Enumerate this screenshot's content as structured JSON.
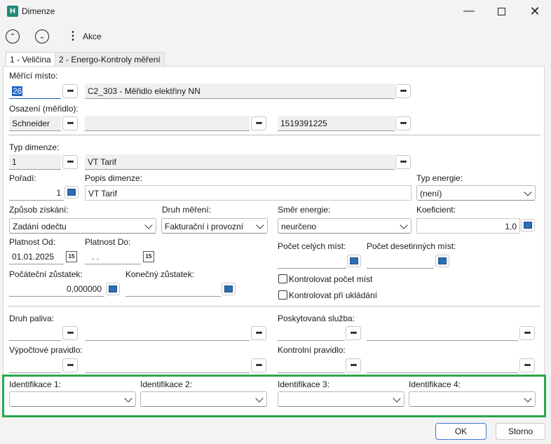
{
  "window": {
    "title": "Dimenze",
    "app_icon": "H"
  },
  "toolbar": {
    "actions_label": "Akce"
  },
  "tabs": [
    {
      "label": "1 - Veličina"
    },
    {
      "label": "2 - Energo-Kontroly měření"
    }
  ],
  "form": {
    "merici_misto": {
      "label": "Měřící místo:",
      "code": "26",
      "name": "C2_303 - Měřidlo elektřiny NN"
    },
    "osazeni": {
      "label": "Osazení (měřidlo):",
      "maker": "Schneider",
      "model": "",
      "serial": "1519391225"
    },
    "typ_dimenze": {
      "label": "Typ dimenze:",
      "code": "1",
      "name": "VT Tarif"
    },
    "poradi": {
      "label": "Pořadí:",
      "value": "1"
    },
    "popis": {
      "label": "Popis dimenze:",
      "value": "VT Tarif"
    },
    "typ_energie": {
      "label": "Typ energie:",
      "value": "(není)"
    },
    "zpusob": {
      "label": "Způsob získání:",
      "value": "Zadání odečtu"
    },
    "druh_mereni": {
      "label": "Druh měření:",
      "value": "Fakturační i provozní"
    },
    "smer": {
      "label": "Směr energie:",
      "value": "neurčeno"
    },
    "koeficient": {
      "label": "Koeficient:",
      "value": "1,0"
    },
    "platnost_od": {
      "label": "Platnost Od:",
      "value": "01.01.2025"
    },
    "platnost_do": {
      "label": "Platnost Do:",
      "value": ". ."
    },
    "pocet_celych": {
      "label": "Počet celých míst:",
      "value": ""
    },
    "pocet_des": {
      "label": "Počet desetinných míst:",
      "value": ""
    },
    "pocatecni": {
      "label": "Počáteční zůstatek:",
      "value": "0,000000"
    },
    "konecny": {
      "label": "Konečný zůstatek:",
      "value": ""
    },
    "kontrolovat_pocet": {
      "label": "Kontrolovat počet míst",
      "checked": false
    },
    "kontrolovat_ukladani": {
      "label": "Kontrolovat při ukládání",
      "checked": false
    },
    "druh_paliva": {
      "label": "Druh paliva:"
    },
    "poskytovana_sluzba": {
      "label": "Poskytovaná služba:"
    },
    "vypoctove": {
      "label": "Výpočtové pravidlo:"
    },
    "kontrolni": {
      "label": "Kontrolní pravidlo:"
    },
    "identifikace": [
      {
        "label": "Identifikace 1:",
        "value": ""
      },
      {
        "label": "Identifikace 2:",
        "value": ""
      },
      {
        "label": "Identifikace 3:",
        "value": ""
      },
      {
        "label": "Identifikace 4:",
        "value": ""
      }
    ]
  },
  "buttons": {
    "ok": "OK",
    "cancel": "Storno"
  },
  "colors": {
    "highlight_box": "#2aa84a",
    "ok_border": "#3b7bd4"
  },
  "icons": [
    "app-icon",
    "minimize-icon",
    "maximize-icon",
    "close-icon",
    "chevron-up-icon",
    "chevron-down-icon",
    "more-vertical-icon",
    "ellipsis-icon",
    "calculator-icon",
    "calendar-icon",
    "dropdown-chevron-icon"
  ]
}
